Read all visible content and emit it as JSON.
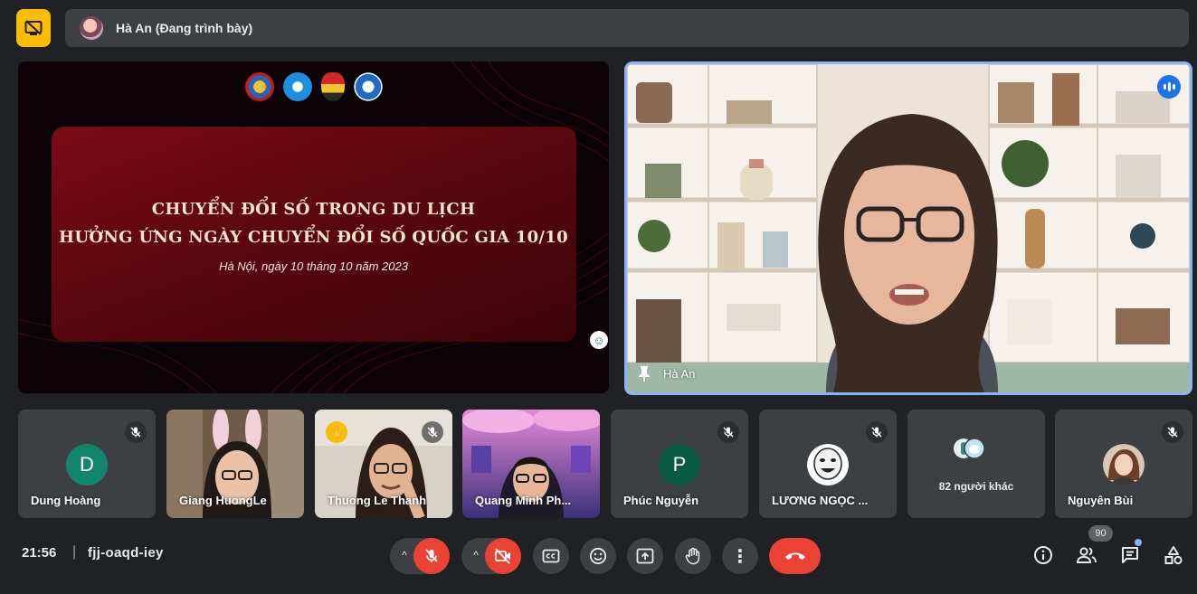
{
  "presenter_bar": {
    "presenter_label": "Hà An (Đang trình bày)"
  },
  "slide": {
    "title_line1": "CHUYỂN ĐỔI SỐ TRONG DU LỊCH",
    "title_line2": "HƯỞNG ỨNG NGÀY CHUYỂN ĐỔI SỐ QUỐC GIA 10/10",
    "date_line": "Hà Nội, ngày 10 tháng 10 năm 2023",
    "reaction_icon": "☺"
  },
  "speaker": {
    "name": "Hà An",
    "pin_icon": "pin-icon",
    "speaking_icon": "audio-level-icon"
  },
  "participants": [
    {
      "name": "Dung Hoàng",
      "initial": "D",
      "avatar_color": "#12866b",
      "muted": true
    },
    {
      "name": "Giang HuongLe",
      "muted": false
    },
    {
      "name": "Thuong Le Thanh",
      "muted": true,
      "hand_raised": true,
      "hand_icon": "👋"
    },
    {
      "name": "Quang Minh Ph...",
      "muted": false
    },
    {
      "name": "Phúc Nguyễn",
      "initial": "P",
      "avatar_color": "#0b5a44",
      "muted": true
    },
    {
      "name": "LƯƠNG NGỌC ...",
      "muted": true
    },
    {
      "name": "82 người khác"
    },
    {
      "name": "Nguyên Bùi",
      "muted": true
    }
  ],
  "controls": {
    "time": "21:56",
    "separator": "|",
    "meeting_code": "fjj-oaqd-iey",
    "caret": "^",
    "more_icon": "⋮"
  },
  "right_controls": {
    "people_count": "90"
  },
  "colors": {
    "background": "#202124",
    "surface": "#3c4043",
    "accent_blue": "#8ab4f8",
    "danger_red": "#ea4335",
    "present_yellow": "#fbbc04"
  }
}
